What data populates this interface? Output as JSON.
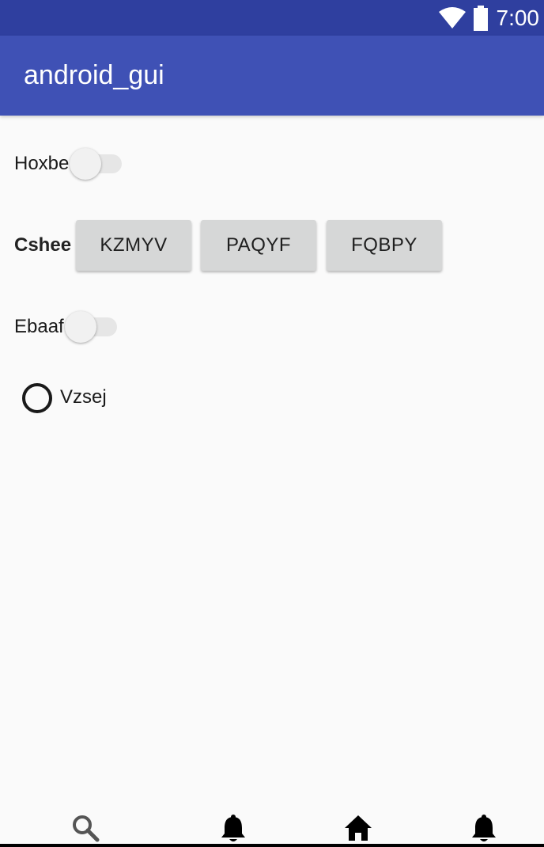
{
  "status_bar": {
    "time": "7:00",
    "icons": [
      "wifi-icon",
      "battery-icon"
    ]
  },
  "app_bar": {
    "title": "android_gui"
  },
  "content": {
    "switch_1": {
      "label": "Hoxbe",
      "checked": false
    },
    "button_row": {
      "label": "Cshee",
      "buttons": [
        "KZMYV",
        "PAQYF",
        "FQBPY"
      ]
    },
    "switch_2": {
      "label": "Ebaaf",
      "checked": false
    },
    "radio": {
      "label": "Vzsej",
      "checked": false
    }
  },
  "bottom_nav": {
    "icons": [
      "search-icon",
      "notification-bell-icon",
      "home-icon",
      "notification-bell-icon"
    ]
  },
  "colors": {
    "status_bar": "#2f3f9f",
    "app_bar": "#3f51b5",
    "background": "#fafafa",
    "button": "#d6d7d7"
  }
}
